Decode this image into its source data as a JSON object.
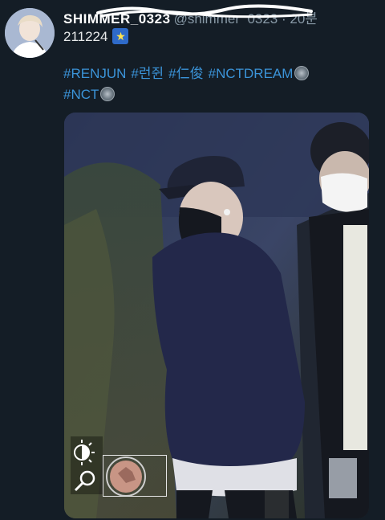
{
  "tweet": {
    "display_name": "SHIMMER_0323",
    "handle": "@shimmer_0323",
    "separator": " · ",
    "time": "20분",
    "text": "211224",
    "emoji": "star-sparkle",
    "hashtags": [
      {
        "text": "#RENJUN"
      },
      {
        "text": "#런쥔"
      },
      {
        "text": "#仁俊"
      },
      {
        "text": "#NCTDREAM"
      },
      {
        "text": "#NCT"
      }
    ]
  },
  "icons": {
    "avatar": "profile-avatar",
    "badge": "nct-badge-icon",
    "brightness": "brightness-icon",
    "search": "search-magnifier-icon"
  },
  "colors": {
    "background": "#141d26",
    "hashtag": "#3b94d9",
    "meta": "#8899a6",
    "text": "#e7e9ea"
  }
}
